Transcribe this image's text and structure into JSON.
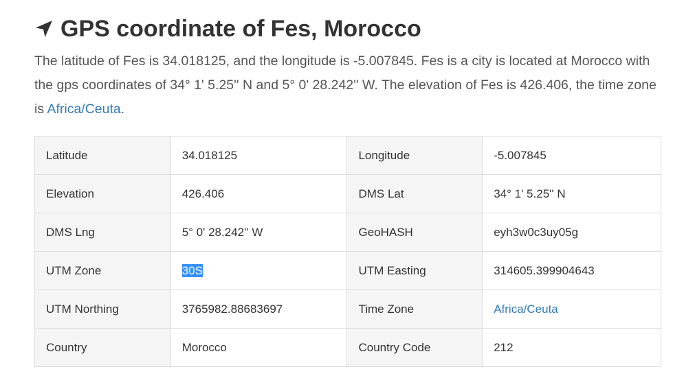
{
  "heading": {
    "prefix": "GPS coordinate of ",
    "place": "Fes, Morocco"
  },
  "intro": {
    "part1": "The latitude of Fes is 34.018125, and the longitude is -5.007845. Fes is a city is located at Morocco with the gps coordinates of 34° 1' 5.25'' N and 5° 0' 28.242'' W. The elevation of Fes is 426.406, the time zone is ",
    "link": "Africa/Ceuta",
    "part2": "."
  },
  "table": {
    "rows": [
      {
        "l1": "Latitude",
        "v1": "34.018125",
        "l2": "Longitude",
        "v2": "-5.007845"
      },
      {
        "l1": "Elevation",
        "v1": "426.406",
        "l2": "DMS Lat",
        "v2": "34° 1' 5.25'' N"
      },
      {
        "l1": "DMS Lng",
        "v1": "5° 0' 28.242'' W",
        "l2": "GeoHASH",
        "v2": "eyh3w0c3uy05g"
      },
      {
        "l1": "UTM Zone",
        "v1": "30S",
        "l2": "UTM Easting",
        "v2": "314605.399904643"
      },
      {
        "l1": "UTM Northing",
        "v1": "3765982.88683697",
        "l2": "Time Zone",
        "v2": "Africa/Ceuta"
      },
      {
        "l1": "Country",
        "v1": "Morocco",
        "l2": "Country Code",
        "v2": "212"
      }
    ]
  },
  "icons": {
    "heading_icon": "location-arrow-icon"
  },
  "colors": {
    "link": "#337ab7",
    "selection": "#3390ff"
  }
}
